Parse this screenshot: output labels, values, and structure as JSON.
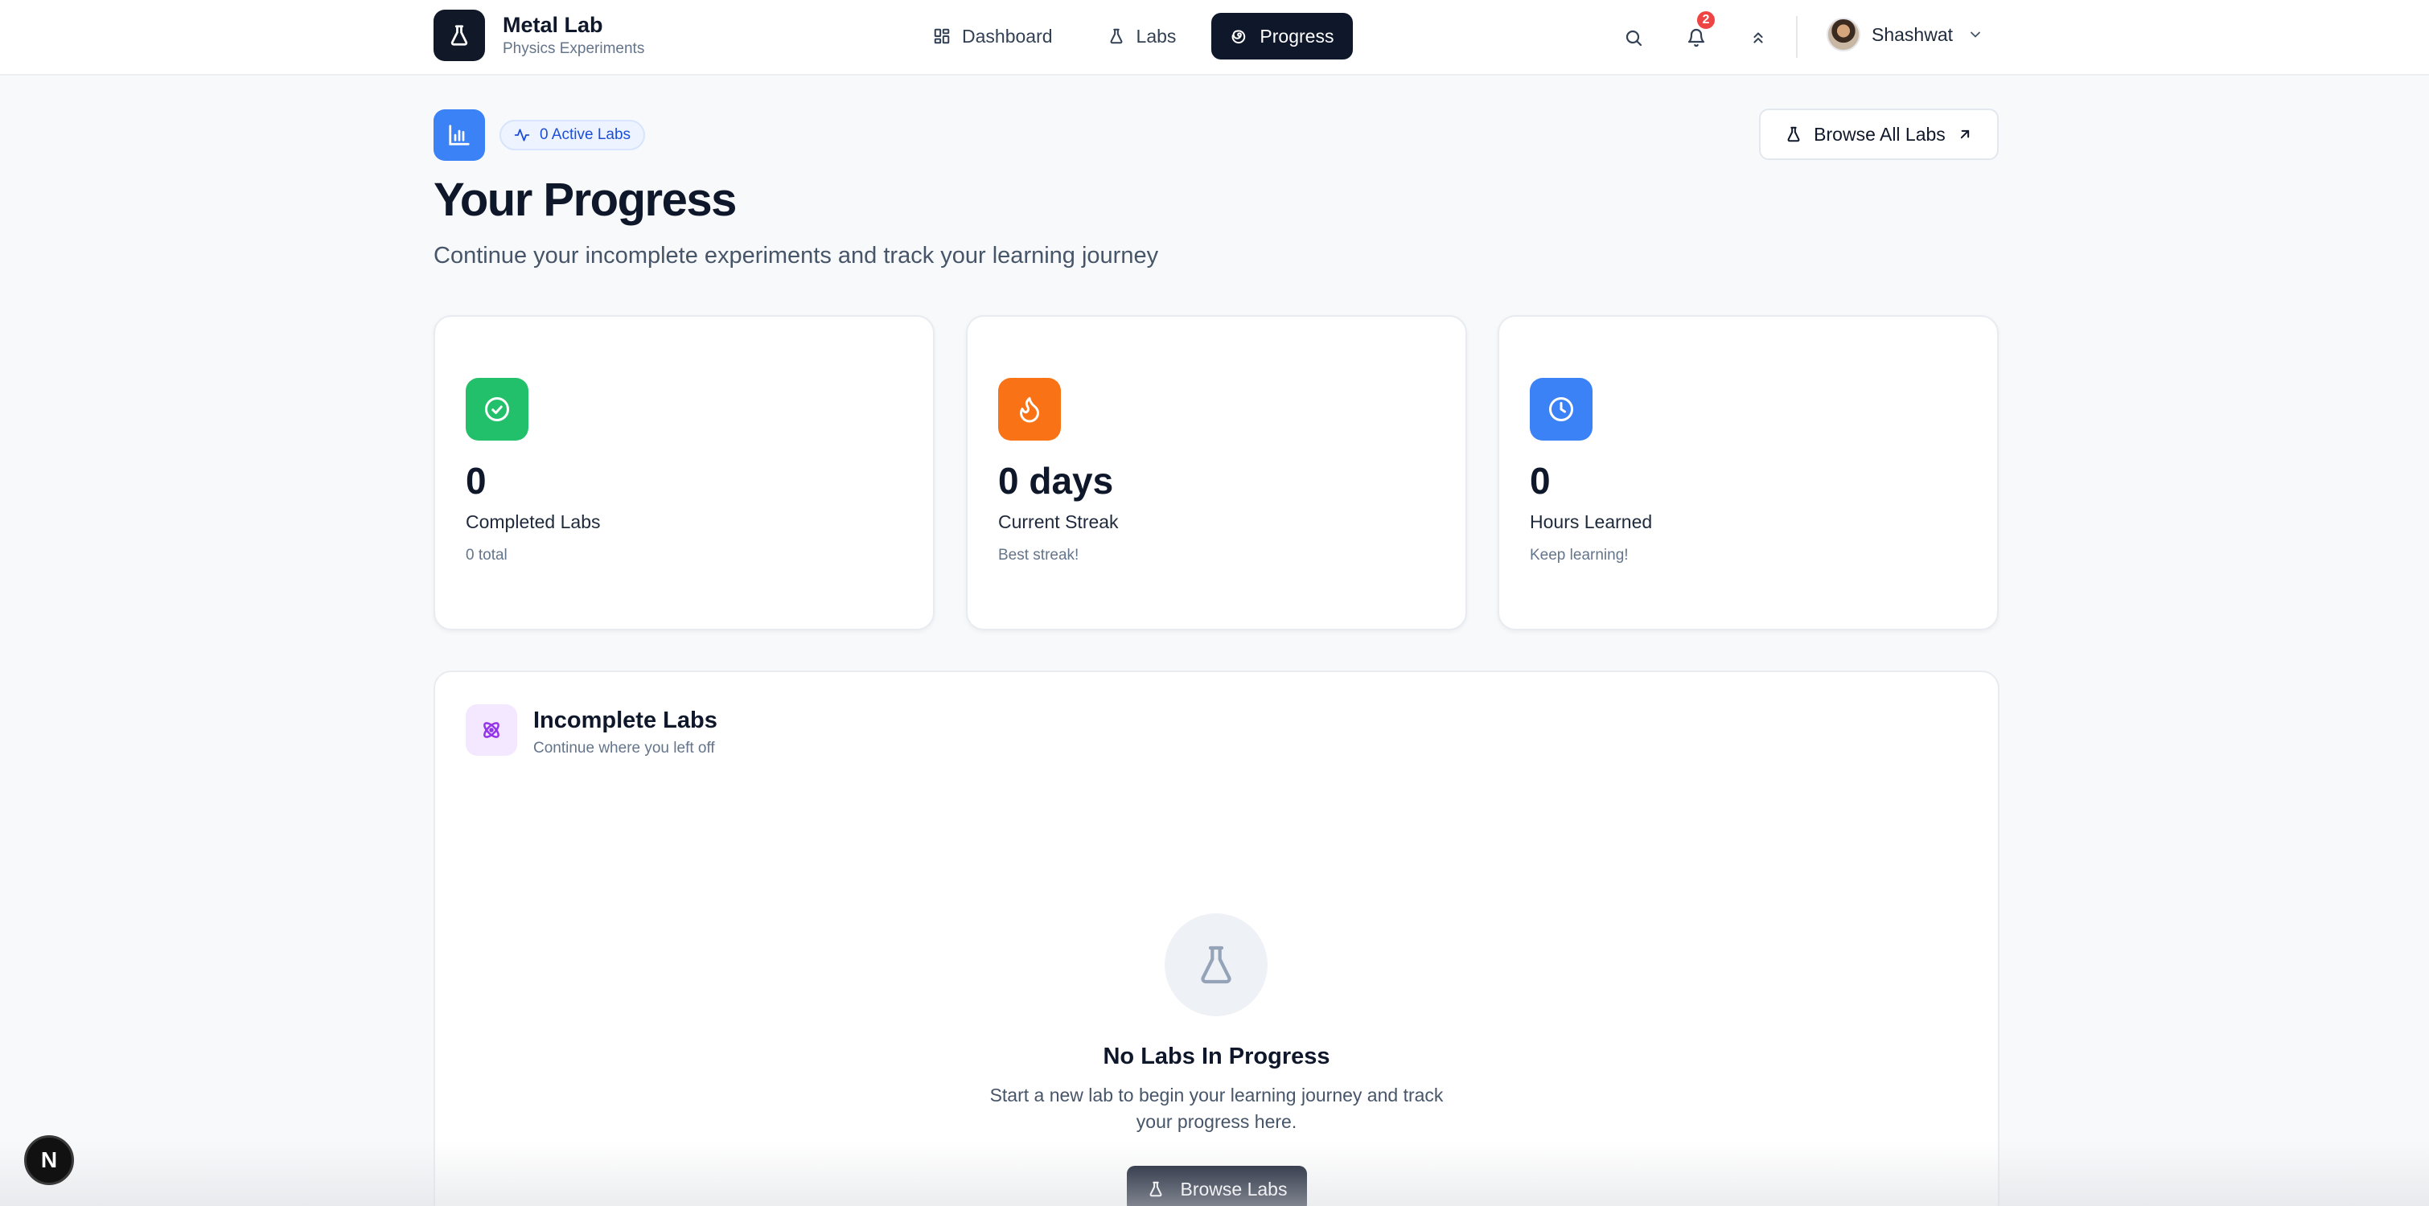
{
  "header": {
    "brand_title": "Metal Lab",
    "brand_subtitle": "Physics Experiments",
    "nav": [
      {
        "label": "Dashboard",
        "icon": "dashboard-grid-icon",
        "active": false
      },
      {
        "label": "Labs",
        "icon": "flask-icon",
        "active": false
      },
      {
        "label": "Progress",
        "icon": "progress-swirl-icon",
        "active": true
      }
    ],
    "notification_count": "2",
    "user_name": "Shashwat"
  },
  "page": {
    "active_badge": "0 Active Labs",
    "browse_all_label": "Browse All Labs",
    "title": "Your Progress",
    "subtitle": "Continue your incomplete experiments and track your learning journey"
  },
  "stats": [
    {
      "value": "0",
      "label": "Completed Labs",
      "note": "0 total",
      "icon": "check-circle-icon",
      "color": "#22c06a"
    },
    {
      "value": "0 days",
      "label": "Current Streak",
      "note": "Best streak!",
      "icon": "flame-icon",
      "color": "#f97316"
    },
    {
      "value": "0",
      "label": "Hours Learned",
      "note": "Keep learning!",
      "icon": "clock-icon",
      "color": "#3b82f6"
    }
  ],
  "incomplete": {
    "title": "Incomplete Labs",
    "subtitle": "Continue where you left off",
    "empty_title": "No Labs In Progress",
    "empty_description": "Start a new lab to begin your learning journey and track your progress here.",
    "button_label": "Browse Labs"
  },
  "dev_badge": "N",
  "colors": {
    "accent_dark": "#0f172a",
    "primary_blue": "#3b82f6",
    "notification_red": "#ef4444",
    "purple_soft": "#f3e8ff"
  }
}
